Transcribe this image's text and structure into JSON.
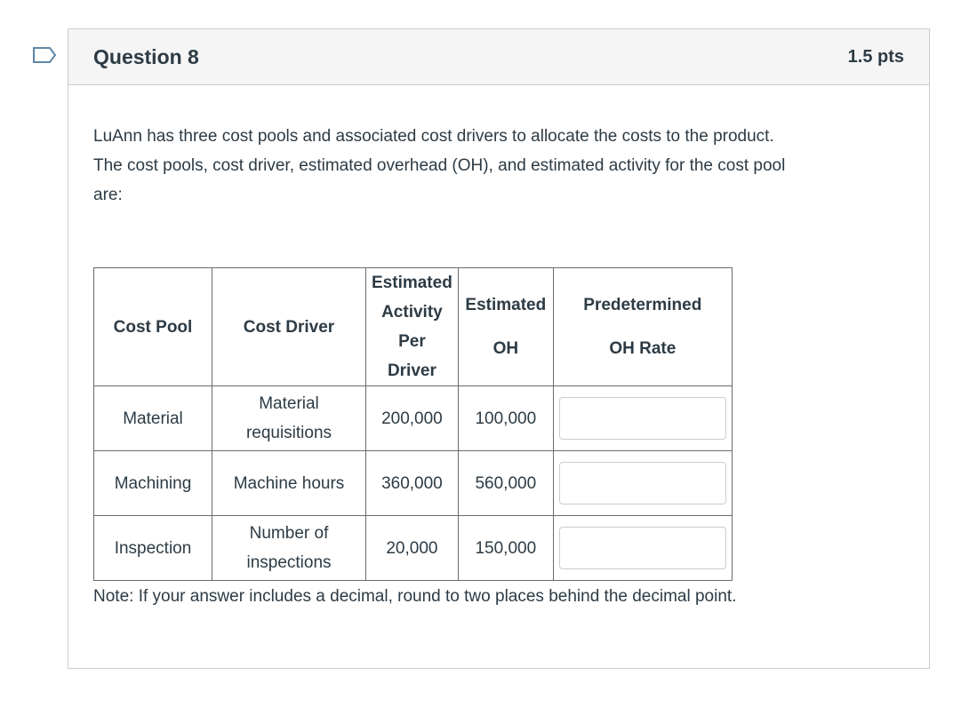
{
  "question": {
    "title": "Question 8",
    "points": "1.5 pts",
    "flag_icon": "bookmark-flag-icon",
    "prompt_lines": [
      "LuAnn has three cost pools and associated cost drivers to allocate the costs to the product.",
      "The cost pools, cost driver, estimated overhead (OH), and estimated activity for the cost pool",
      "are:"
    ],
    "table": {
      "headers": {
        "cost_pool": "Cost Pool",
        "cost_driver": "Cost Driver",
        "est_activity_1": "Estimated",
        "est_activity_2": "Activity",
        "est_activity_3": "Per Driver",
        "est_oh_1": "Estimated",
        "est_oh_2": "OH",
        "rate_1": "Predetermined",
        "rate_2": "OH Rate"
      },
      "rows": [
        {
          "cost_pool": "Material",
          "driver_1": "Material",
          "driver_2": "requisitions",
          "activity": "200,000",
          "oh": "100,000",
          "answer_value": ""
        },
        {
          "cost_pool": "Machining",
          "driver_1": "Machine hours",
          "driver_2": "",
          "activity": "360,000",
          "oh": "560,000",
          "answer_value": ""
        },
        {
          "cost_pool": "Inspection",
          "driver_1": "Number of",
          "driver_2": "inspections",
          "activity": "20,000",
          "oh": "150,000",
          "answer_value": ""
        }
      ]
    },
    "note": "Note: If your answer includes a decimal, round to two places behind the decimal point."
  }
}
